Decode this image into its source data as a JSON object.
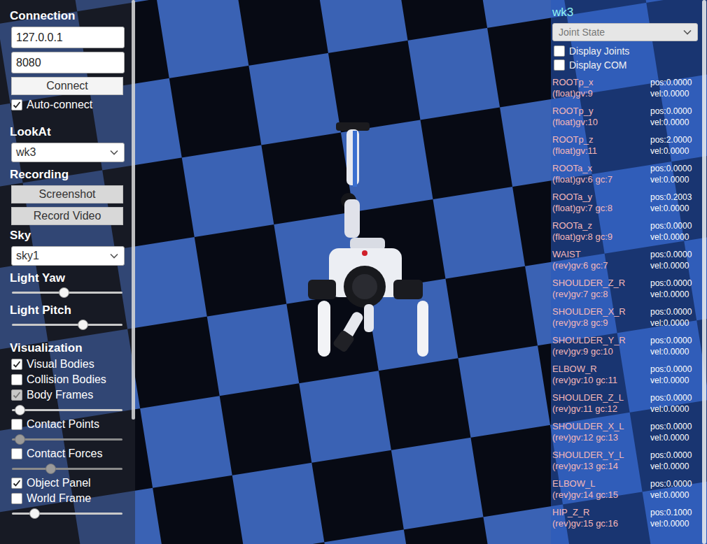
{
  "left_panel": {
    "connection": {
      "title": "Connection",
      "host": "127.0.0.1",
      "port": "8080",
      "button": "Connect",
      "auto_connect": {
        "label": "Auto-connect",
        "checked": true
      }
    },
    "lookat": {
      "title": "LookAt",
      "value": "wk3"
    },
    "recording": {
      "title": "Recording",
      "buttons": [
        "Screenshot",
        "Record Video"
      ]
    },
    "sky": {
      "title": "Sky",
      "value": "sky1"
    },
    "lights": [
      {
        "label": "Light Yaw",
        "level": 0.47
      },
      {
        "label": "Light Pitch",
        "level": 0.64
      }
    ],
    "visualization": {
      "title": "Visualization",
      "items": [
        {
          "kind": "checkbox",
          "label": "Visual Bodies",
          "checked": true,
          "disabled": false
        },
        {
          "kind": "checkbox",
          "label": "Collision Bodies",
          "checked": false,
          "disabled": false
        },
        {
          "kind": "checkbox",
          "label": "Body Frames",
          "checked": true,
          "disabled": true
        },
        {
          "kind": "slider",
          "level": 0.07,
          "disabled": false
        },
        {
          "kind": "checkbox",
          "label": "Contact Points",
          "checked": false,
          "disabled": false
        },
        {
          "kind": "slider",
          "level": 0.07,
          "disabled": true
        },
        {
          "kind": "checkbox",
          "label": "Contact Forces",
          "checked": false,
          "disabled": false
        },
        {
          "kind": "slider",
          "level": 0.35,
          "disabled": true
        },
        {
          "kind": "checkbox",
          "label": "Object Panel",
          "checked": true,
          "disabled": false
        },
        {
          "kind": "checkbox",
          "label": "World Frame",
          "checked": false,
          "disabled": false
        },
        {
          "kind": "slider",
          "level": 0.2,
          "disabled": false
        }
      ]
    }
  },
  "right_panel": {
    "title": "wk3",
    "view": "Joint State",
    "options": [
      {
        "label": "Display Joints",
        "checked": false
      },
      {
        "label": "Display COM",
        "checked": false
      }
    ],
    "joints": [
      {
        "name": "ROOTp_x",
        "info": "(float)gv:9",
        "pos": "pos:0.0000",
        "vel": "vel:0.0000"
      },
      {
        "name": "ROOTp_y",
        "info": "(float)gv:10",
        "pos": "pos:0.0000",
        "vel": "vel:0.0000"
      },
      {
        "name": "ROOTp_z",
        "info": "(float)gv:11",
        "pos": "pos:2.0000",
        "vel": "vel:0.0000"
      },
      {
        "name": "ROOTa_x",
        "info": "(float)gv:6 gc:7",
        "pos": "pos:0.0000",
        "vel": "vel:0.0000"
      },
      {
        "name": "ROOTa_y",
        "info": "(float)gv:7 gc:8",
        "pos": "pos:0.2003",
        "vel": "vel:0.0000"
      },
      {
        "name": "ROOTa_z",
        "info": "(float)gv:8 gc:9",
        "pos": "pos:0.0000",
        "vel": "vel:0.0000"
      },
      {
        "name": "WAIST",
        "info": "(rev)gv:6 gc:7",
        "pos": "pos:0.0000",
        "vel": "vel:0.0000"
      },
      {
        "name": "SHOULDER_Z_R",
        "info": "(rev)gv:7 gc:8",
        "pos": "pos:0.0000",
        "vel": "vel:0.0000"
      },
      {
        "name": "SHOULDER_X_R",
        "info": "(rev)gv:8 gc:9",
        "pos": "pos:0.0000",
        "vel": "vel:0.0000"
      },
      {
        "name": "SHOULDER_Y_R",
        "info": "(rev)gv:9 gc:10",
        "pos": "pos:0.0000",
        "vel": "vel:0.0000"
      },
      {
        "name": "ELBOW_R",
        "info": "(rev)gv:10 gc:11",
        "pos": "pos:0.0000",
        "vel": "vel:0.0000"
      },
      {
        "name": "SHOULDER_Z_L",
        "info": "(rev)gv:11 gc:12",
        "pos": "pos:0.0000",
        "vel": "vel:0.0000"
      },
      {
        "name": "SHOULDER_X_L",
        "info": "(rev)gv:12 gc:13",
        "pos": "pos:0.0000",
        "vel": "vel:0.0000"
      },
      {
        "name": "SHOULDER_Y_L",
        "info": "(rev)gv:13 gc:14",
        "pos": "pos:0.0000",
        "vel": "vel:0.0000"
      },
      {
        "name": "ELBOW_L",
        "info": "(rev)gv:14 gc:15",
        "pos": "pos:0.0000",
        "vel": "vel:0.0000"
      },
      {
        "name": "HIP_Z_R",
        "info": "(rev)gv:15 gc:16",
        "pos": "pos:0.1000",
        "vel": "vel:0.0000"
      }
    ]
  }
}
